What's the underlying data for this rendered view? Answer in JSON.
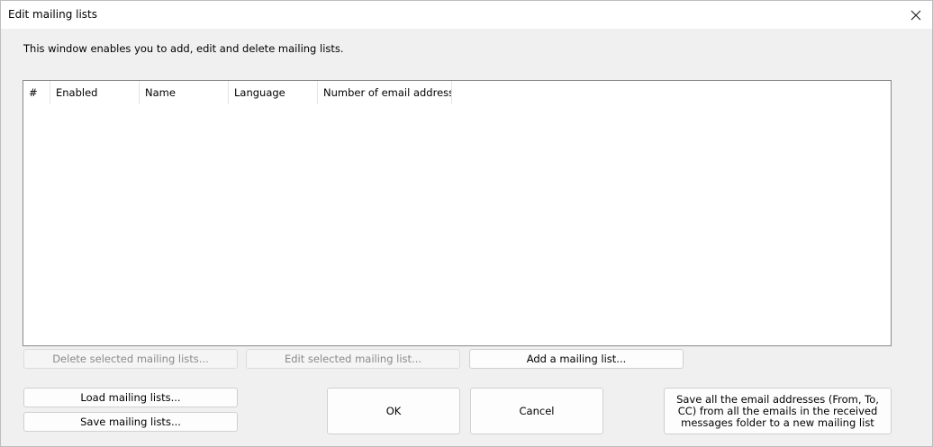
{
  "window": {
    "title": "Edit mailing lists"
  },
  "description": "This window enables you to add, edit and delete mailing lists.",
  "listview": {
    "columns": [
      "#",
      "Enabled",
      "Name",
      "Language",
      "Number of email addresses"
    ],
    "rows": []
  },
  "buttons": {
    "delete_selected": "Delete selected mailing lists...",
    "edit_selected": "Edit selected mailing list...",
    "add": "Add a mailing list...",
    "load": "Load mailing lists...",
    "save": "Save mailing lists...",
    "ok": "OK",
    "cancel": "Cancel",
    "save_all_addresses": "Save all the email addresses (From, To, CC) from all the emails in the received messages folder to a new mailing list"
  },
  "icons": {
    "close": "close-icon"
  }
}
